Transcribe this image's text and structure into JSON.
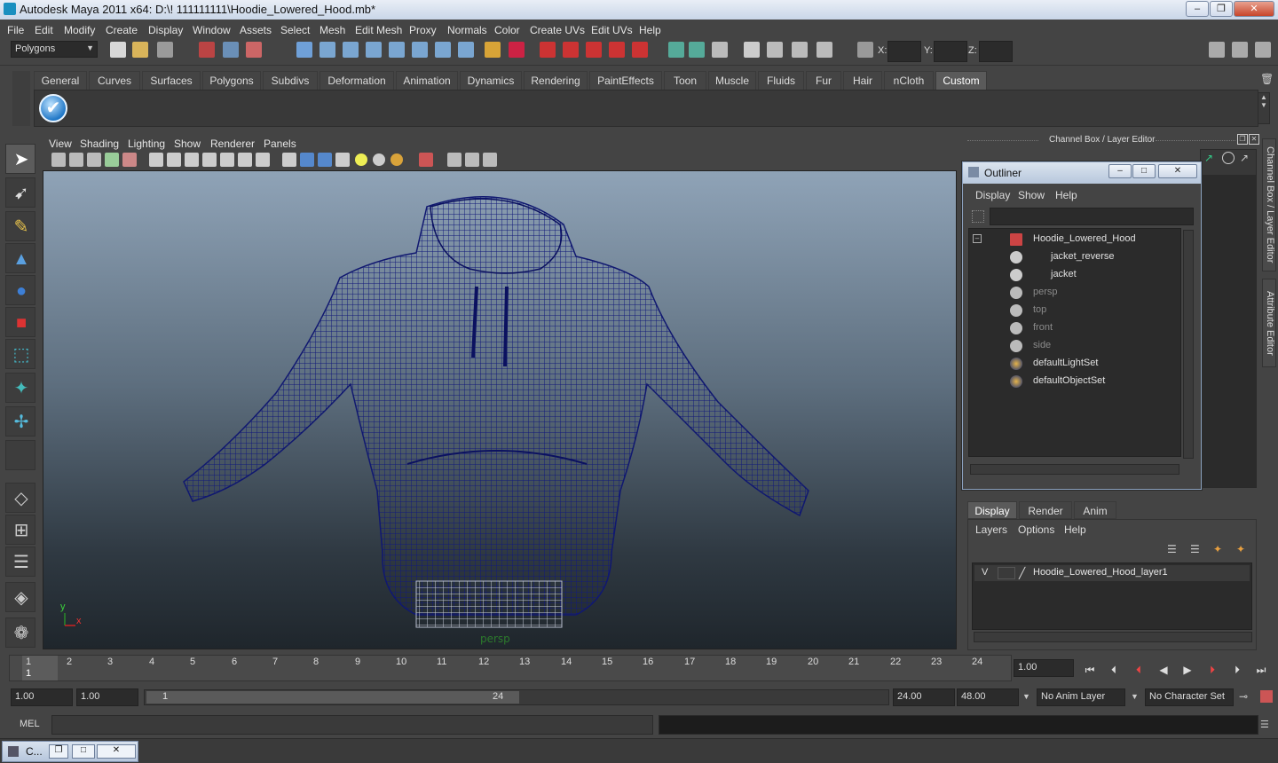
{
  "window": {
    "title": "Autodesk Maya 2011 x64: D:\\! 111111111\\Hoodie_Lowered_Hood.mb*",
    "minimize": "–",
    "maximize": "❐",
    "close": "✕"
  },
  "menubar": [
    "File",
    "Edit",
    "Modify",
    "Create",
    "Display",
    "Window",
    "Assets",
    "Select",
    "Mesh",
    "Edit Mesh",
    "Proxy",
    "Normals",
    "Color",
    "Create UVs",
    "Edit UVs",
    "Help"
  ],
  "statusline": {
    "mode": "Polygons",
    "x_label": "X:",
    "y_label": "Y:",
    "z_label": "Z:"
  },
  "shelf": {
    "tabs": [
      "General",
      "Curves",
      "Surfaces",
      "Polygons",
      "Subdivs",
      "Deformation",
      "Animation",
      "Dynamics",
      "Rendering",
      "PaintEffects",
      "Toon",
      "Muscle",
      "Fluids",
      "Fur",
      "Hair",
      "nCloth",
      "Custom"
    ],
    "active_tab": "Custom",
    "check_icon": "✔"
  },
  "viewport": {
    "menus": [
      "View",
      "Shading",
      "Lighting",
      "Show",
      "Renderer",
      "Panels"
    ],
    "camera_label": "persp",
    "axis_y": "y",
    "axis_x": "x"
  },
  "channel_box": {
    "header": "Channel Box / Layer Editor"
  },
  "right_dock_tabs": [
    "Channel Box / Layer Editor",
    "Attribute Editor"
  ],
  "outliner": {
    "title": "Outliner",
    "menus": [
      "Display",
      "Show",
      "Help"
    ],
    "items": [
      {
        "label": "Hoodie_Lowered_Hood",
        "indent": 0,
        "dim": false,
        "icon": "transform-icon"
      },
      {
        "label": "jacket_reverse",
        "indent": 1,
        "dim": false,
        "icon": "mesh-icon"
      },
      {
        "label": "jacket",
        "indent": 1,
        "dim": false,
        "icon": "mesh-icon"
      },
      {
        "label": "persp",
        "indent": 0,
        "dim": true,
        "icon": "camera-icon"
      },
      {
        "label": "top",
        "indent": 0,
        "dim": true,
        "icon": "camera-icon"
      },
      {
        "label": "front",
        "indent": 0,
        "dim": true,
        "icon": "camera-icon"
      },
      {
        "label": "side",
        "indent": 0,
        "dim": true,
        "icon": "camera-icon"
      },
      {
        "label": "defaultLightSet",
        "indent": 0,
        "dim": false,
        "icon": "set-icon"
      },
      {
        "label": "defaultObjectSet",
        "indent": 0,
        "dim": false,
        "icon": "set-icon"
      }
    ]
  },
  "layer_editor": {
    "tabs": [
      "Display",
      "Render",
      "Anim"
    ],
    "active_tab": "Display",
    "menus": [
      "Layers",
      "Options",
      "Help"
    ],
    "layers": [
      {
        "visible": "V",
        "name": "Hoodie_Lowered_Hood_layer1"
      }
    ]
  },
  "timeline": {
    "ticks": [
      "1",
      "2",
      "3",
      "4",
      "5",
      "6",
      "7",
      "8",
      "9",
      "10",
      "11",
      "12",
      "13",
      "14",
      "15",
      "16",
      "17",
      "18",
      "19",
      "20",
      "21",
      "22",
      "23",
      "24"
    ],
    "current_marker": "1",
    "current_frame": "1.00"
  },
  "range": {
    "start": "1.00",
    "playback_start": "1.00",
    "slider_start": "1",
    "slider_end": "24",
    "playback_end": "24.00",
    "end": "48.00",
    "anim_layer": "No Anim Layer",
    "character_set": "No Character Set"
  },
  "command": {
    "label": "MEL"
  },
  "taskbar": {
    "item": "C..."
  }
}
